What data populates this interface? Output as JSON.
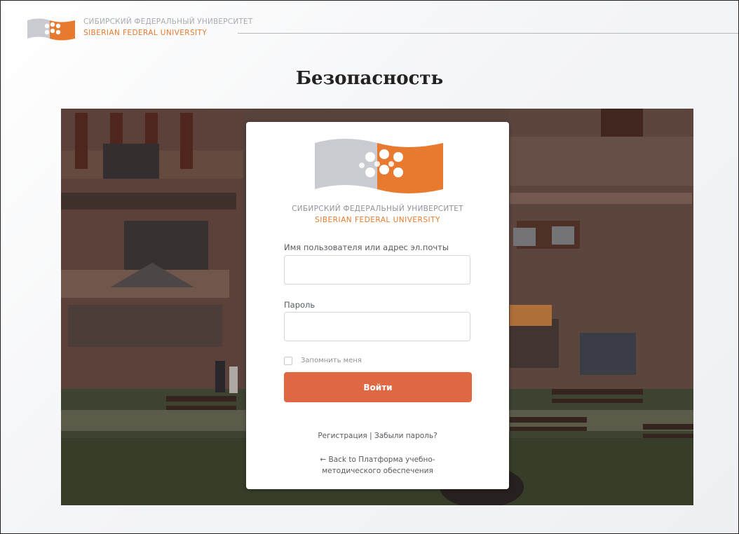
{
  "header": {
    "university_ru": "СИБИРСКИЙ ФЕДЕРАЛЬНЫЙ УНИВЕРСИТЕТ",
    "university_en": "SIBERIAN FEDERAL UNIVERSITY",
    "logo_icon": "sfu-logo-icon"
  },
  "slide": {
    "title": "Безопасность"
  },
  "login_form": {
    "logo_icon": "sfu-logo-icon",
    "university_ru": "СИБИРСКИЙ ФЕДЕРАЛЬНЫЙ УНИВЕРСИТЕТ",
    "university_en": "SIBERIAN FEDERAL UNIVERSITY",
    "username_label": "Имя пользователя или адрес эл.почты",
    "username_value": "",
    "password_label": "Пароль",
    "password_value": "",
    "remember_label": "Запомнить меня",
    "remember_checked": false,
    "login_button": "Войти",
    "register_link": "Регистрация",
    "links_separator": " | ",
    "forgot_link": "Забыли пароль?",
    "back_link_line1": "← Back to Платформа учебно-",
    "back_link_line2": "методического обеспечения"
  },
  "colors": {
    "brand_orange": "#e77a2f",
    "button": "#df6843",
    "logo_grey": "#c9cbd1"
  }
}
